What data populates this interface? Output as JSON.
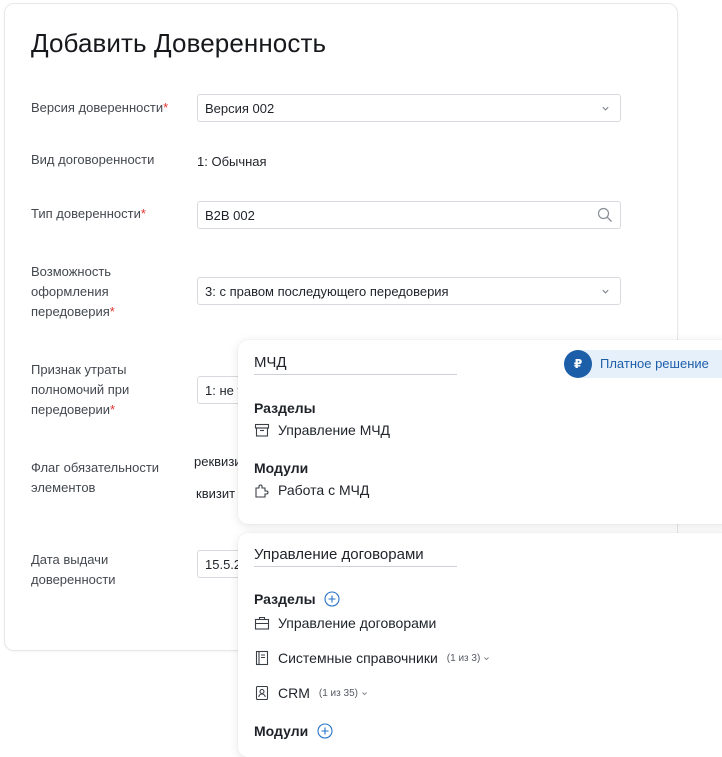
{
  "form": {
    "title": "Добавить Доверенность",
    "fields": {
      "version": {
        "label": "Версия доверенности",
        "value": "Версия 002"
      },
      "contract_kind": {
        "label": "Вид договоренности",
        "value": "1: Обычная"
      },
      "type": {
        "label": "Тип доверенности",
        "value": "B2B 002"
      },
      "redelegation": {
        "label_lines": [
          "Возможность",
          "оформления",
          "передоверия"
        ],
        "value": "3: с правом последующего передоверия"
      },
      "loss_flag": {
        "label_lines": [
          "Признак утраты",
          "полномочий при",
          "передоверии"
        ],
        "value_fragment": "1: не у"
      },
      "mandatory_flag": {
        "label_lines": [
          "Флаг обязательности",
          "элементов"
        ],
        "fragment_1": "реквизи",
        "fragment_2": "квизит"
      },
      "issue_date": {
        "label_lines": [
          "Дата выдачи",
          "доверенности"
        ],
        "value_fragment": "15.5.2"
      }
    },
    "required_mark": "*"
  },
  "mchd_panel": {
    "title": "МЧД",
    "badge": {
      "icon": "ruble-icon",
      "symbol": "₽",
      "label": "Платное решение",
      "color": "#1d5ea9"
    },
    "sections_heading": "Разделы",
    "sections": [
      {
        "icon": "archive-box-icon",
        "label": "Управление МЧД"
      }
    ],
    "modules_heading": "Модули",
    "modules": [
      {
        "icon": "puzzle-icon",
        "label": "Работа с МЧД"
      }
    ]
  },
  "contracts_panel": {
    "title": "Управление договорами",
    "sections_heading": "Разделы",
    "sections": [
      {
        "icon": "briefcase-icon",
        "label": "Управление договорами",
        "count": ""
      },
      {
        "icon": "book-icon",
        "label": "Системные справочники",
        "count": "(1 из 3)"
      },
      {
        "icon": "contact-card-icon",
        "label": "CRM",
        "count": "(1 из 35)"
      }
    ],
    "modules_heading": "Модули"
  }
}
